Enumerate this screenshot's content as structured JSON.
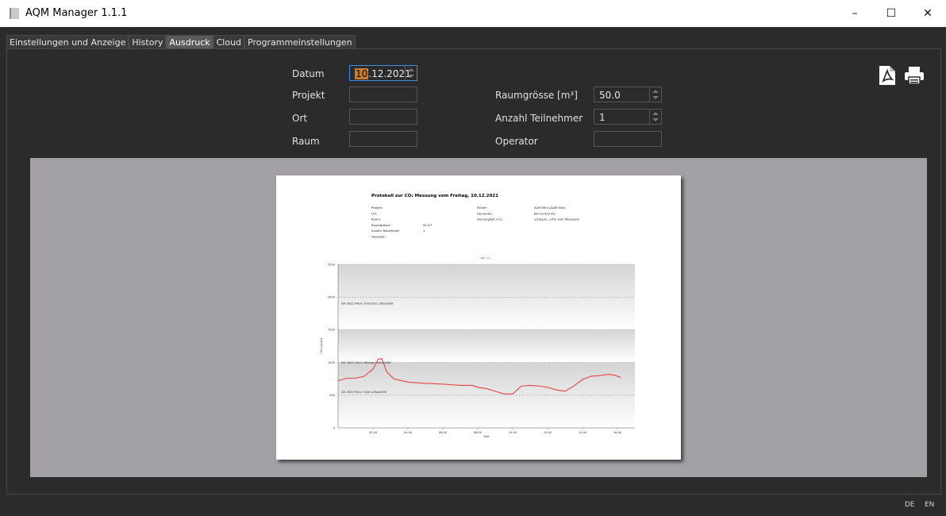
{
  "window": {
    "title": "AQM Manager 1.1.1",
    "min_icon": "–",
    "max_icon": "☐",
    "close_icon": "✕"
  },
  "tabs": [
    {
      "label": "Einstellungen und Anzeige"
    },
    {
      "label": "History"
    },
    {
      "label": "Ausdruck"
    },
    {
      "label": "Cloud"
    },
    {
      "label": "Programmeinstellungen"
    }
  ],
  "form": {
    "datum_label": "Datum",
    "datum_value_sel": "10",
    "datum_value_rest": ".12.2021",
    "projekt_label": "Projekt",
    "projekt_value": "",
    "ort_label": "Ort",
    "ort_value": "",
    "raum_label": "Raum",
    "raum_value": "",
    "raumgroesse_label": "Raumgrösse [m³]",
    "raumgroesse_value": "50.0",
    "teilnehmer_label": "Anzahl Teilnehmer",
    "teilnehmer_value": "1",
    "operator_label": "Operator",
    "operator_value": ""
  },
  "toolbar": {
    "pdf_icon": "pdf-icon",
    "print_icon": "printer-icon"
  },
  "report": {
    "title": "Protokoll zur CO₂ Messung vom Freitag, 10.12.2021",
    "left_labels": [
      "Projekt:",
      "Ort:",
      "Raum:",
      "Raumgrösse:",
      "Anzahl Teilnehmer:",
      "Operator:"
    ],
    "left_values": [
      "",
      "",
      "",
      "50 m³",
      "1",
      ""
    ],
    "right_labels": [
      "Fühler:",
      "Hersteller:",
      "Genauigkeit CO₂:"
    ],
    "right_values": [
      "AQM Mini (AQM Mini)",
      "BV-Control AG",
      "±50ppm, ±5% vom Messwert"
    ]
  },
  "chart_data": {
    "type": "line",
    "legend": "CO₂",
    "ylabel": "CO₂ [ppm]",
    "xlabel": "Zeit",
    "ylim": [
      0,
      2500
    ],
    "yticks": [
      "0",
      "500",
      "1000",
      "1500",
      "2000",
      "2500"
    ],
    "xticks": [
      "02:00",
      "04:00",
      "06:00",
      "08:00",
      "10:00",
      "12:00",
      "14:00",
      "16:00"
    ],
    "band_labels": [
      "SIA 382/1 RAL4: Schlechte Luftqualität",
      "SIA 382/1 RAL3: Mässige Luftqualität",
      "SIA 382/1 RAL2: Gute Luftqualität"
    ],
    "series": [
      {
        "name": "CO₂",
        "color": "#e84545",
        "x": [
          0,
          0.5,
          1.0,
          1.5,
          2.0,
          2.3,
          2.5,
          2.8,
          3.2,
          4,
          5,
          6,
          7,
          7.7,
          8,
          8.5,
          9,
          9.5,
          10,
          10.5,
          11,
          11.5,
          12,
          12.5,
          13,
          13.5,
          14,
          14.5,
          15,
          15.5,
          15.9,
          16.2
        ],
        "y": [
          720,
          760,
          760,
          790,
          900,
          1050,
          1060,
          850,
          750,
          700,
          680,
          670,
          650,
          650,
          620,
          600,
          560,
          520,
          520,
          640,
          650,
          640,
          620,
          580,
          560,
          640,
          740,
          790,
          800,
          820,
          800,
          770
        ]
      }
    ]
  },
  "footer": {
    "lang_de": "DE",
    "lang_en": "EN"
  }
}
